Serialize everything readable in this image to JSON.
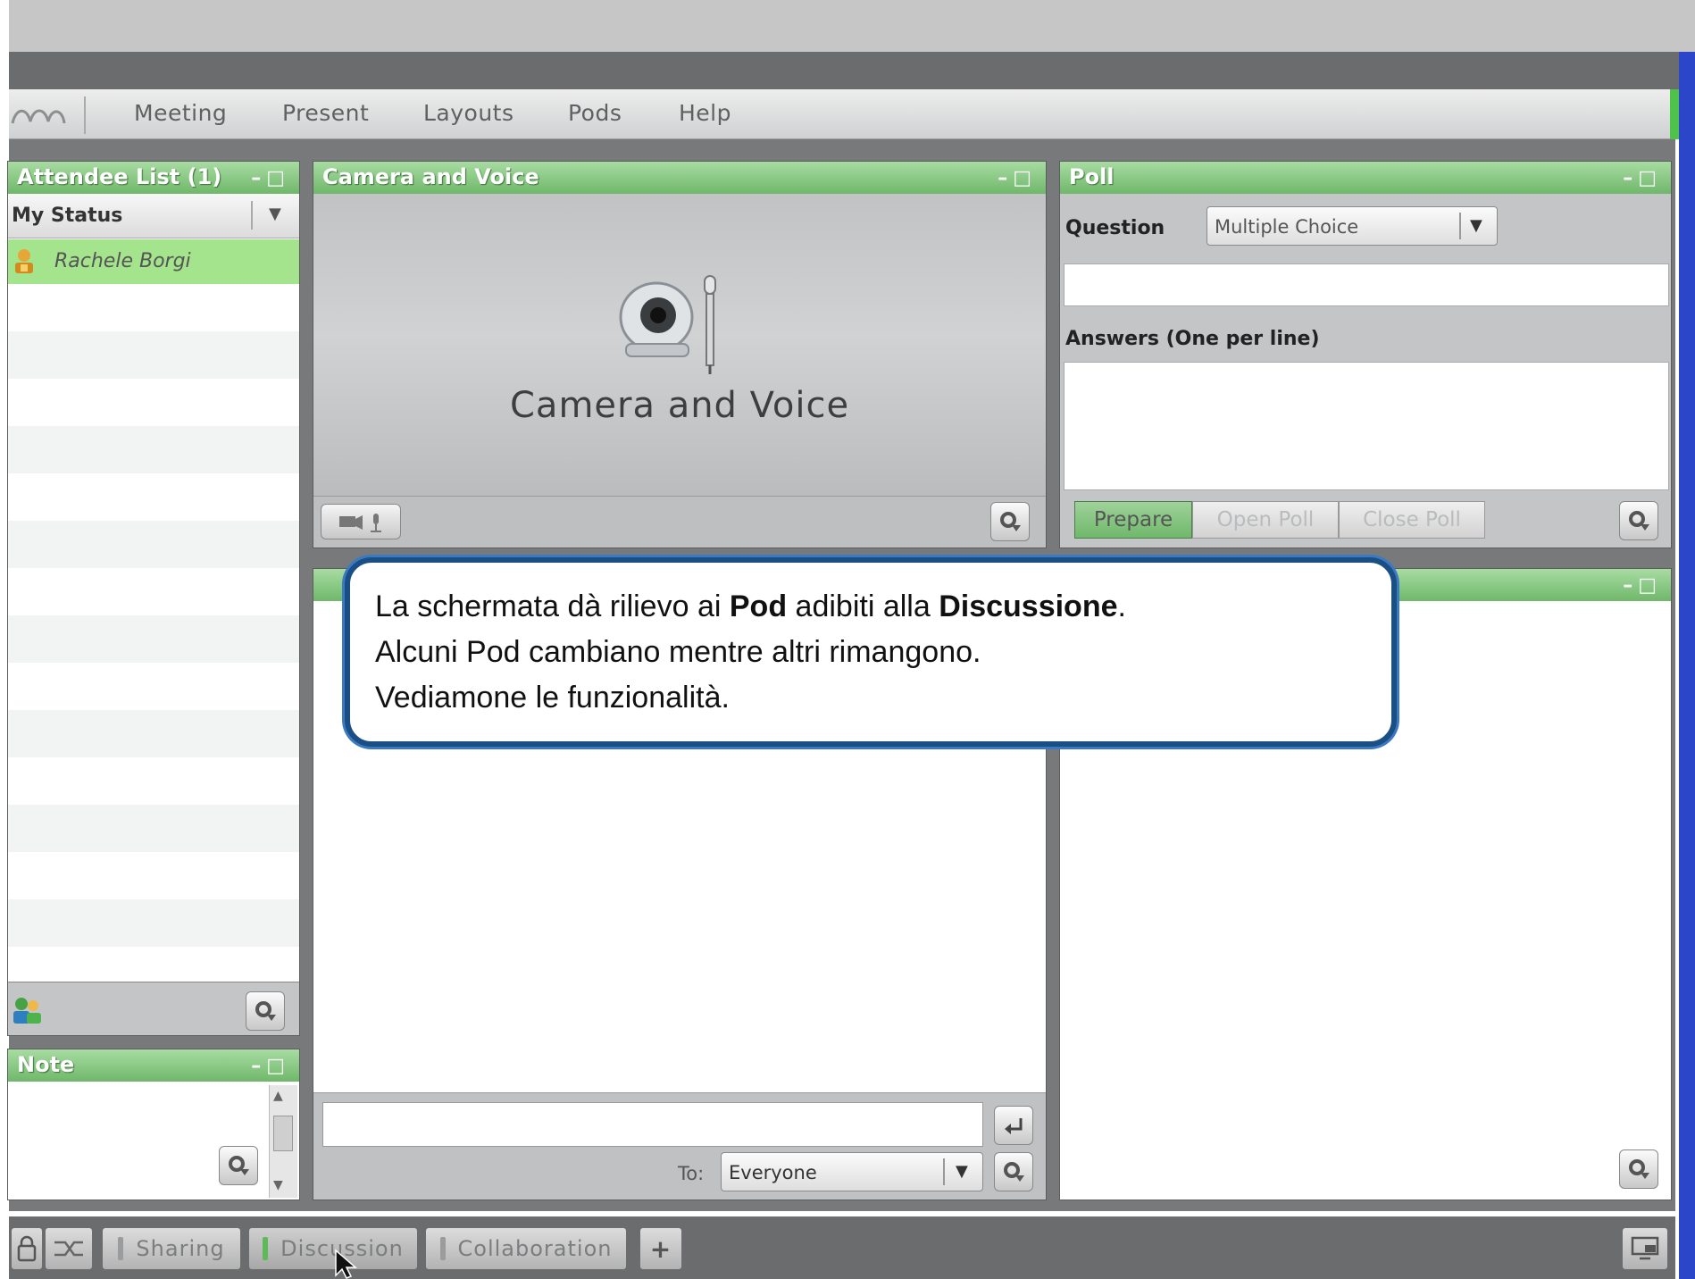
{
  "menu": {
    "items": [
      "Meeting",
      "Present",
      "Layouts",
      "Pods",
      "Help"
    ]
  },
  "attendee_pod": {
    "title": "Attendee List (1)",
    "my_status_label": "My Status",
    "attendee_name": "Rachele Borgi"
  },
  "camera_pod": {
    "title": "Camera and Voice",
    "placeholder_label": "Camera and Voice"
  },
  "poll_pod": {
    "title": "Poll",
    "question_label": "Question",
    "question_type": "Multiple Choice",
    "answers_label": "Answers (One per line)",
    "prepare_label": "Prepare",
    "open_poll_label": "Open Poll",
    "close_poll_label": "Close Poll"
  },
  "note_pod": {
    "title": "Note"
  },
  "chat_pod": {
    "to_label": "To:",
    "recipient": "Everyone"
  },
  "callout": {
    "line1_a": "La schermata dà rilievo ai ",
    "line1_b": "Pod",
    "line1_c": " adibiti alla ",
    "line1_d": "Discussione",
    "line1_e": ".",
    "line2": "Alcuni Pod cambiano mentre altri rimangono.",
    "line3": "Vediamone le funzionalità."
  },
  "tabs": {
    "sharing": "Sharing",
    "discussion": "Discussion",
    "collaboration": "Collaboration",
    "add": "+"
  },
  "colors": {
    "pod_title_green": "#6fb86a",
    "callout_border": "#1a4f85",
    "highlight_green": "#a4e48c"
  }
}
